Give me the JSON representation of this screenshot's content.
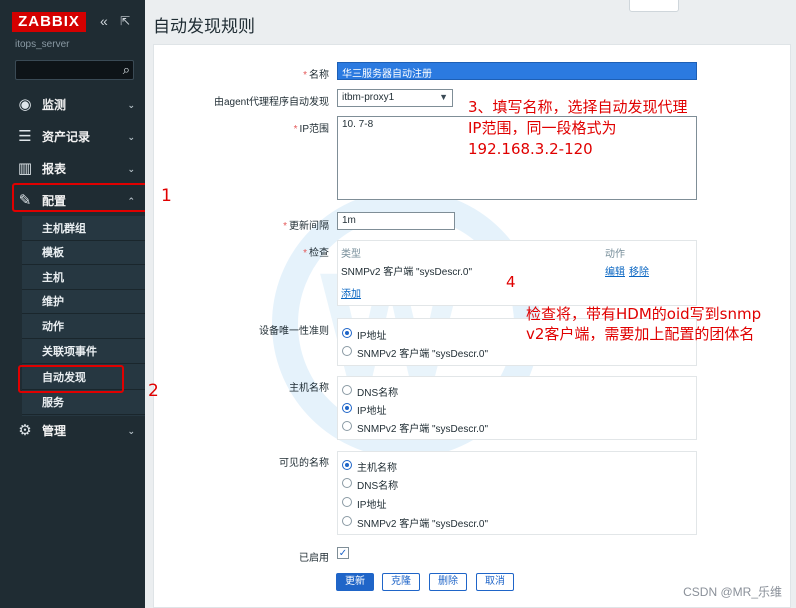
{
  "sidebar": {
    "logo": "ZABBIX",
    "collapse_icon": "«",
    "expand_icon": "⇱",
    "server_name": "itops_server",
    "search_icon": "🔍",
    "menu": [
      {
        "label": "监测",
        "icon": "eye-icon",
        "glyph": "◉"
      },
      {
        "label": "资产记录",
        "icon": "list-icon",
        "glyph": "☰"
      },
      {
        "label": "报表",
        "icon": "chart-icon",
        "glyph": "▥"
      },
      {
        "label": "配置",
        "icon": "wrench-icon",
        "glyph": "🔧"
      },
      {
        "label": "管理",
        "icon": "gear-icon",
        "glyph": "⚙"
      }
    ],
    "submenu": [
      "主机群组",
      "模板",
      "主机",
      "维护",
      "动作",
      "关联项事件",
      "自动发现",
      "服务"
    ],
    "chevron_down": "⌄",
    "chevron_up": "⌃"
  },
  "page": {
    "title": "自动发现规则"
  },
  "form": {
    "name_label": "名称",
    "name_value": "华三服务器自动注册",
    "proxy_label": "由agent代理程序自动发现",
    "proxy_value": "itbm-proxy1",
    "ip_label": "IP范围",
    "ip_value": "10.        7-8",
    "interval_label": "更新间隔",
    "interval_value": "1m",
    "checks_label": "检查",
    "checks_col_type": "类型",
    "checks_col_action": "动作",
    "check_row_type": "SNMPv2 客户端 \"sysDescr.0\"",
    "check_edit": "编辑",
    "check_remove": "移除",
    "check_add": "添加",
    "uniqueness_label": "设备唯一性准则",
    "uniqueness_options": [
      "IP地址",
      "SNMPv2 客户端 \"sysDescr.0\""
    ],
    "hostname_label": "主机名称",
    "hostname_options": [
      "DNS名称",
      "IP地址",
      "SNMPv2 客户端 \"sysDescr.0\""
    ],
    "visible_label": "可见的名称",
    "visible_options": [
      "主机名称",
      "DNS名称",
      "IP地址",
      "SNMPv2 客户端 \"sysDescr.0\""
    ],
    "enabled_label": "已启用",
    "enabled_checked": true,
    "buttons": {
      "update": "更新",
      "clone": "克隆",
      "delete": "删除",
      "cancel": "取消"
    }
  },
  "annotations": {
    "a1": "1",
    "a2": "2",
    "a3_line1": "3、填写名称，选择自动发现代理",
    "a3_line2": "IP范围，同一段格式为",
    "a3_line3": "192.168.3.2-120",
    "a4_num": "4",
    "a4_line1": "检查将，带有HDM的oid写到snmp",
    "a4_line2": "v2客户端，需要加上配置的团体名"
  },
  "watermark_text": "CSDN @MR_乐维",
  "colors": {
    "sidebar": "#1f2c33",
    "logo": "#d40000",
    "primary": "#1f65c8",
    "annotation": "#e00000"
  }
}
